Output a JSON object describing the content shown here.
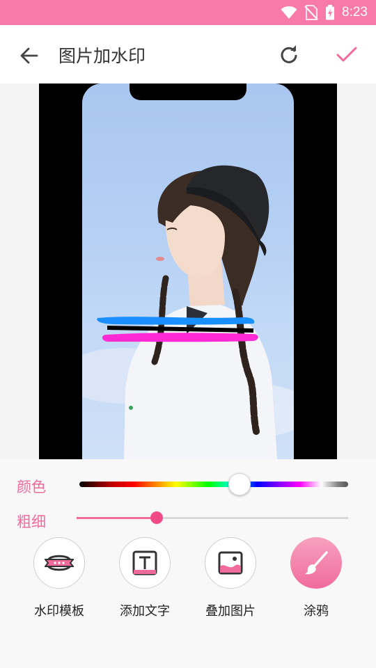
{
  "status_bar": {
    "time": "8:23"
  },
  "app_bar": {
    "title": "图片加水印"
  },
  "color_row": {
    "label": "颜色",
    "thumb_color": "#ffffff"
  },
  "width_row": {
    "label": "粗细"
  },
  "tools": [
    {
      "label": "水印模板",
      "icon": "watermark-template-icon",
      "active": false
    },
    {
      "label": "添加文字",
      "icon": "add-text-icon",
      "active": false
    },
    {
      "label": "叠加图片",
      "icon": "overlay-image-icon",
      "active": false
    },
    {
      "label": "涂鸦",
      "icon": "brush-icon",
      "active": true
    }
  ],
  "colors": {
    "accent": "#f06b9b",
    "status_bar": "#f77aa8",
    "stroke_blue": "#1a8fff",
    "stroke_black": "#000000",
    "stroke_magenta": "#ff2ad4"
  }
}
